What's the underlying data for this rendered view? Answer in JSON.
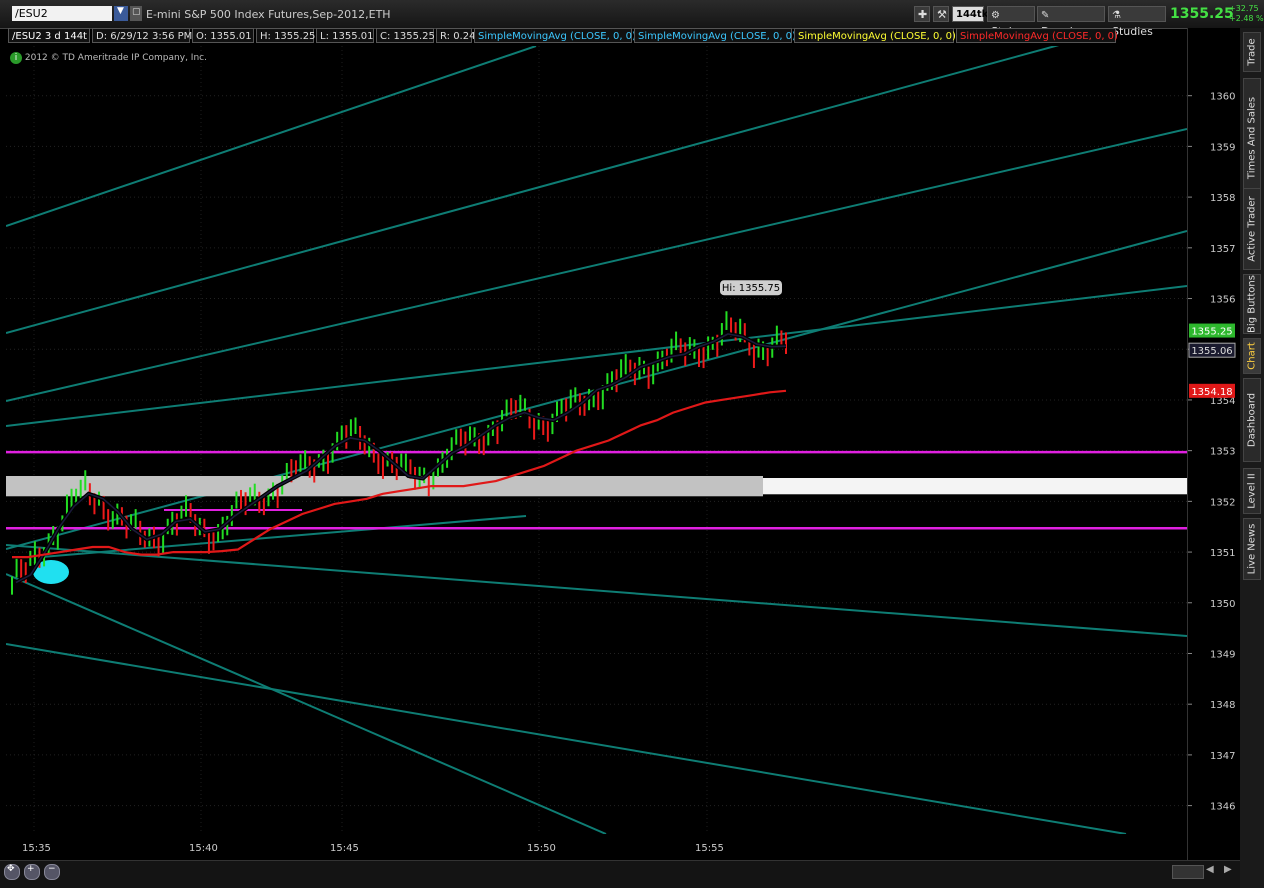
{
  "header": {
    "symbol": "/ESU2",
    "description": "E-mini S&P 500 Index Futures,Sep-2012,ETH",
    "tick_setting": "144tk",
    "style_label": "Style",
    "drawings_label": "Drawings",
    "studies_label": "Studies",
    "last_price": "1355.25",
    "change_abs": "+32.75",
    "change_pct": "+2.48 %"
  },
  "status": {
    "chart_label": "/ESU2 3 d 144t",
    "date": "D: 6/29/12 3:56 PM",
    "open": "O: 1355.01",
    "high": "H: 1355.25",
    "low": "L: 1355.01",
    "close": "C: 1355.25",
    "range": "R: 0.24",
    "studies": [
      {
        "label": "SimpleMovingAvg (CLOSE, 0, 0)",
        "color": "#3cc8ff"
      },
      {
        "label": "SimpleMovingAvg (CLOSE, 0, 0)",
        "color": "#3cc8ff"
      },
      {
        "label": "SimpleMovingAvg (CLOSE, 0, 0)",
        "color": "#ffff33"
      },
      {
        "label": "SimpleMovingAvg (CLOSE, 0, 0)",
        "color": "#ff2a2a"
      }
    ]
  },
  "copyright": "2012 © TD Ameritrade IP Company, Inc.",
  "side_tabs": [
    "Trade",
    "Times And Sales",
    "Active Trader",
    "Big Buttons",
    "Chart",
    "Dashboard",
    "Level II",
    "Live News"
  ],
  "chart_data": {
    "type": "line",
    "title": "",
    "y_ticks": [
      1346,
      1347,
      1348,
      1349,
      1350,
      1351,
      1352,
      1353,
      1354,
      1355,
      1356,
      1357,
      1358,
      1359,
      1360
    ],
    "x_ticks": [
      "15:35",
      "15:40",
      "15:45",
      "15:50",
      "15:55"
    ],
    "ylim": [
      1345.44,
      1360.98
    ],
    "price_labels": [
      {
        "text": "1355.25",
        "value": 1355.25,
        "color": "#2db82d"
      },
      {
        "text": "1355.06",
        "value": 1355.06,
        "color": "#1a1a2e"
      },
      {
        "text": "1354.18",
        "value": 1354.18,
        "color": "#e01818"
      }
    ],
    "hi_annotation": {
      "text": "Hi: 1355.75",
      "value": 1355.75
    },
    "series": [
      {
        "name": "",
        "color": "#0c0c1c",
        "values": [
          1350.4,
          1350.55,
          1351.0,
          1351.5,
          1351.9,
          1352.15,
          1352.05,
          1351.8,
          1351.45,
          1351.25,
          1351.35,
          1351.6,
          1351.65,
          1351.4,
          1351.45,
          1351.7,
          1351.9,
          1352.1,
          1352.3,
          1352.45,
          1352.6,
          1352.85,
          1353.1,
          1353.25,
          1353.2,
          1353.0,
          1352.75,
          1352.5,
          1352.45,
          1352.7,
          1352.95,
          1353.1,
          1353.3,
          1353.5,
          1353.65,
          1353.75,
          1353.65,
          1353.6,
          1353.75,
          1353.95,
          1354.2,
          1354.3,
          1354.45,
          1354.65,
          1354.75,
          1354.85,
          1354.9,
          1355.05,
          1355.15,
          1355.3,
          1355.25,
          1355.1,
          1355.05,
          1355.06
        ]
      },
      {
        "name": "",
        "color": "#e01818",
        "values": [
          1350.9,
          1350.9,
          1350.95,
          1351.0,
          1351.05,
          1351.1,
          1351.1,
          1351.0,
          1350.95,
          1350.95,
          1351.0,
          1351.0,
          1351.0,
          1351.02,
          1351.05,
          1351.25,
          1351.45,
          1351.6,
          1351.75,
          1351.85,
          1351.95,
          1352.0,
          1352.05,
          1352.15,
          1352.2,
          1352.25,
          1352.3,
          1352.3,
          1352.3,
          1352.35,
          1352.4,
          1352.5,
          1352.6,
          1352.7,
          1352.85,
          1353.0,
          1353.1,
          1353.2,
          1353.35,
          1353.5,
          1353.6,
          1353.75,
          1353.85,
          1353.95,
          1354.0,
          1354.05,
          1354.1,
          1354.15,
          1354.18
        ]
      }
    ],
    "horizontal_lines": [
      {
        "value": 1352.97,
        "color": "#e020e0"
      },
      {
        "value": 1351.47,
        "color": "#e020e0"
      }
    ],
    "shaded_band": {
      "from": 1352.1,
      "to": 1352.5
    }
  }
}
